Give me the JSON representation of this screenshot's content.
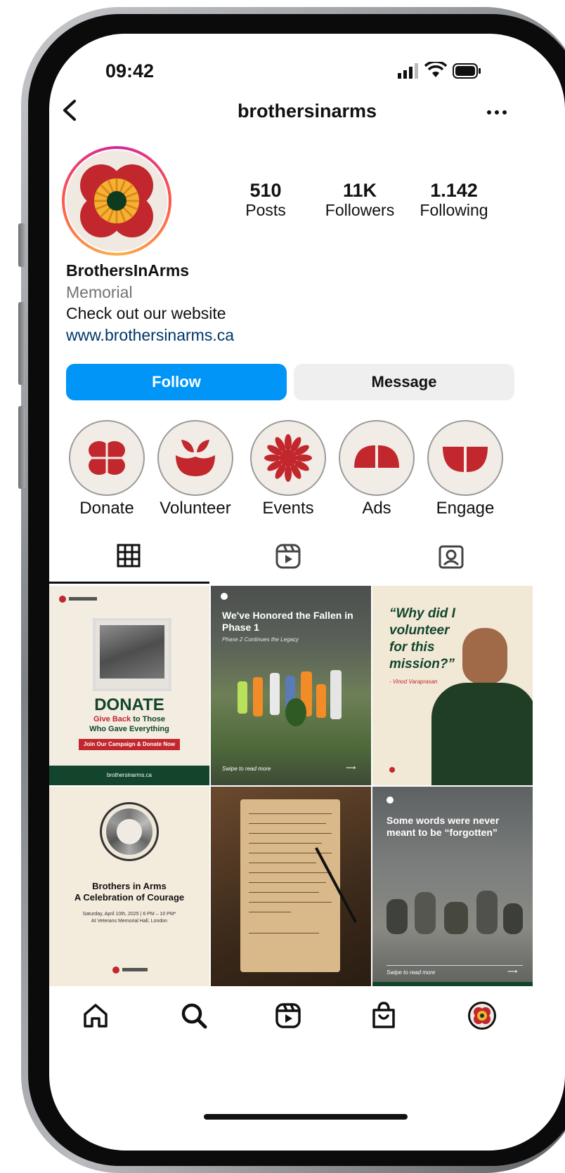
{
  "status_bar": {
    "time": "09:42"
  },
  "header": {
    "username": "brothersinarms",
    "back_icon": "chevron-left-icon",
    "more_icon": "more-horizontal-icon"
  },
  "profile": {
    "stats": [
      {
        "value": "510",
        "label": "Posts"
      },
      {
        "value": "11K",
        "label": "Followers"
      },
      {
        "value": "1.142",
        "label": "Following"
      }
    ],
    "name": "BrothersInArms",
    "category": "Memorial",
    "bio": "Check out our website",
    "link": "www.brothersinarms.ca"
  },
  "actions": {
    "follow_label": "Follow",
    "message_label": "Message"
  },
  "highlights": [
    {
      "label": "Donate"
    },
    {
      "label": "Volunteer"
    },
    {
      "label": "Events"
    },
    {
      "label": "Ads"
    },
    {
      "label": "Engage"
    }
  ],
  "tabs": [
    "grid-icon",
    "reels-icon",
    "tagged-icon"
  ],
  "posts": {
    "donate": {
      "title": "DONATE",
      "line1_red": "Give Back",
      "line1_rest": " to Those",
      "line2": "Who Gave Everything",
      "cta": "Join Our Campaign & Donate Now",
      "footer": "brothersinarms.ca"
    },
    "honored": {
      "title": "We've Honored the Fallen in Phase 1",
      "subtitle": "Phase 2 Continues the Legacy",
      "swipe": "Swipe to read more"
    },
    "volunteer": {
      "quote": "“Why did I volunteer for this mission?”",
      "attribution": "- Vinod Varaprasan"
    },
    "celebration": {
      "title": "Brothers in Arms",
      "subtitle": "A Celebration of Courage",
      "date": "Saturday, April 10th, 2025 | 6 PM – 10 PM*",
      "venue": "At Veterans Memorial Hall, London"
    },
    "words": {
      "title": "Some words were never meant to be “forgotten”",
      "swipe": "Swipe to read more"
    }
  },
  "bottom_nav": [
    "home-icon",
    "search-icon",
    "reels-icon",
    "shop-icon",
    "profile-avatar"
  ],
  "colors": {
    "accent_blue": "#0095f6",
    "brand_red": "#c1272d",
    "brand_yellow": "#f4b233",
    "brand_green": "#12452c"
  }
}
